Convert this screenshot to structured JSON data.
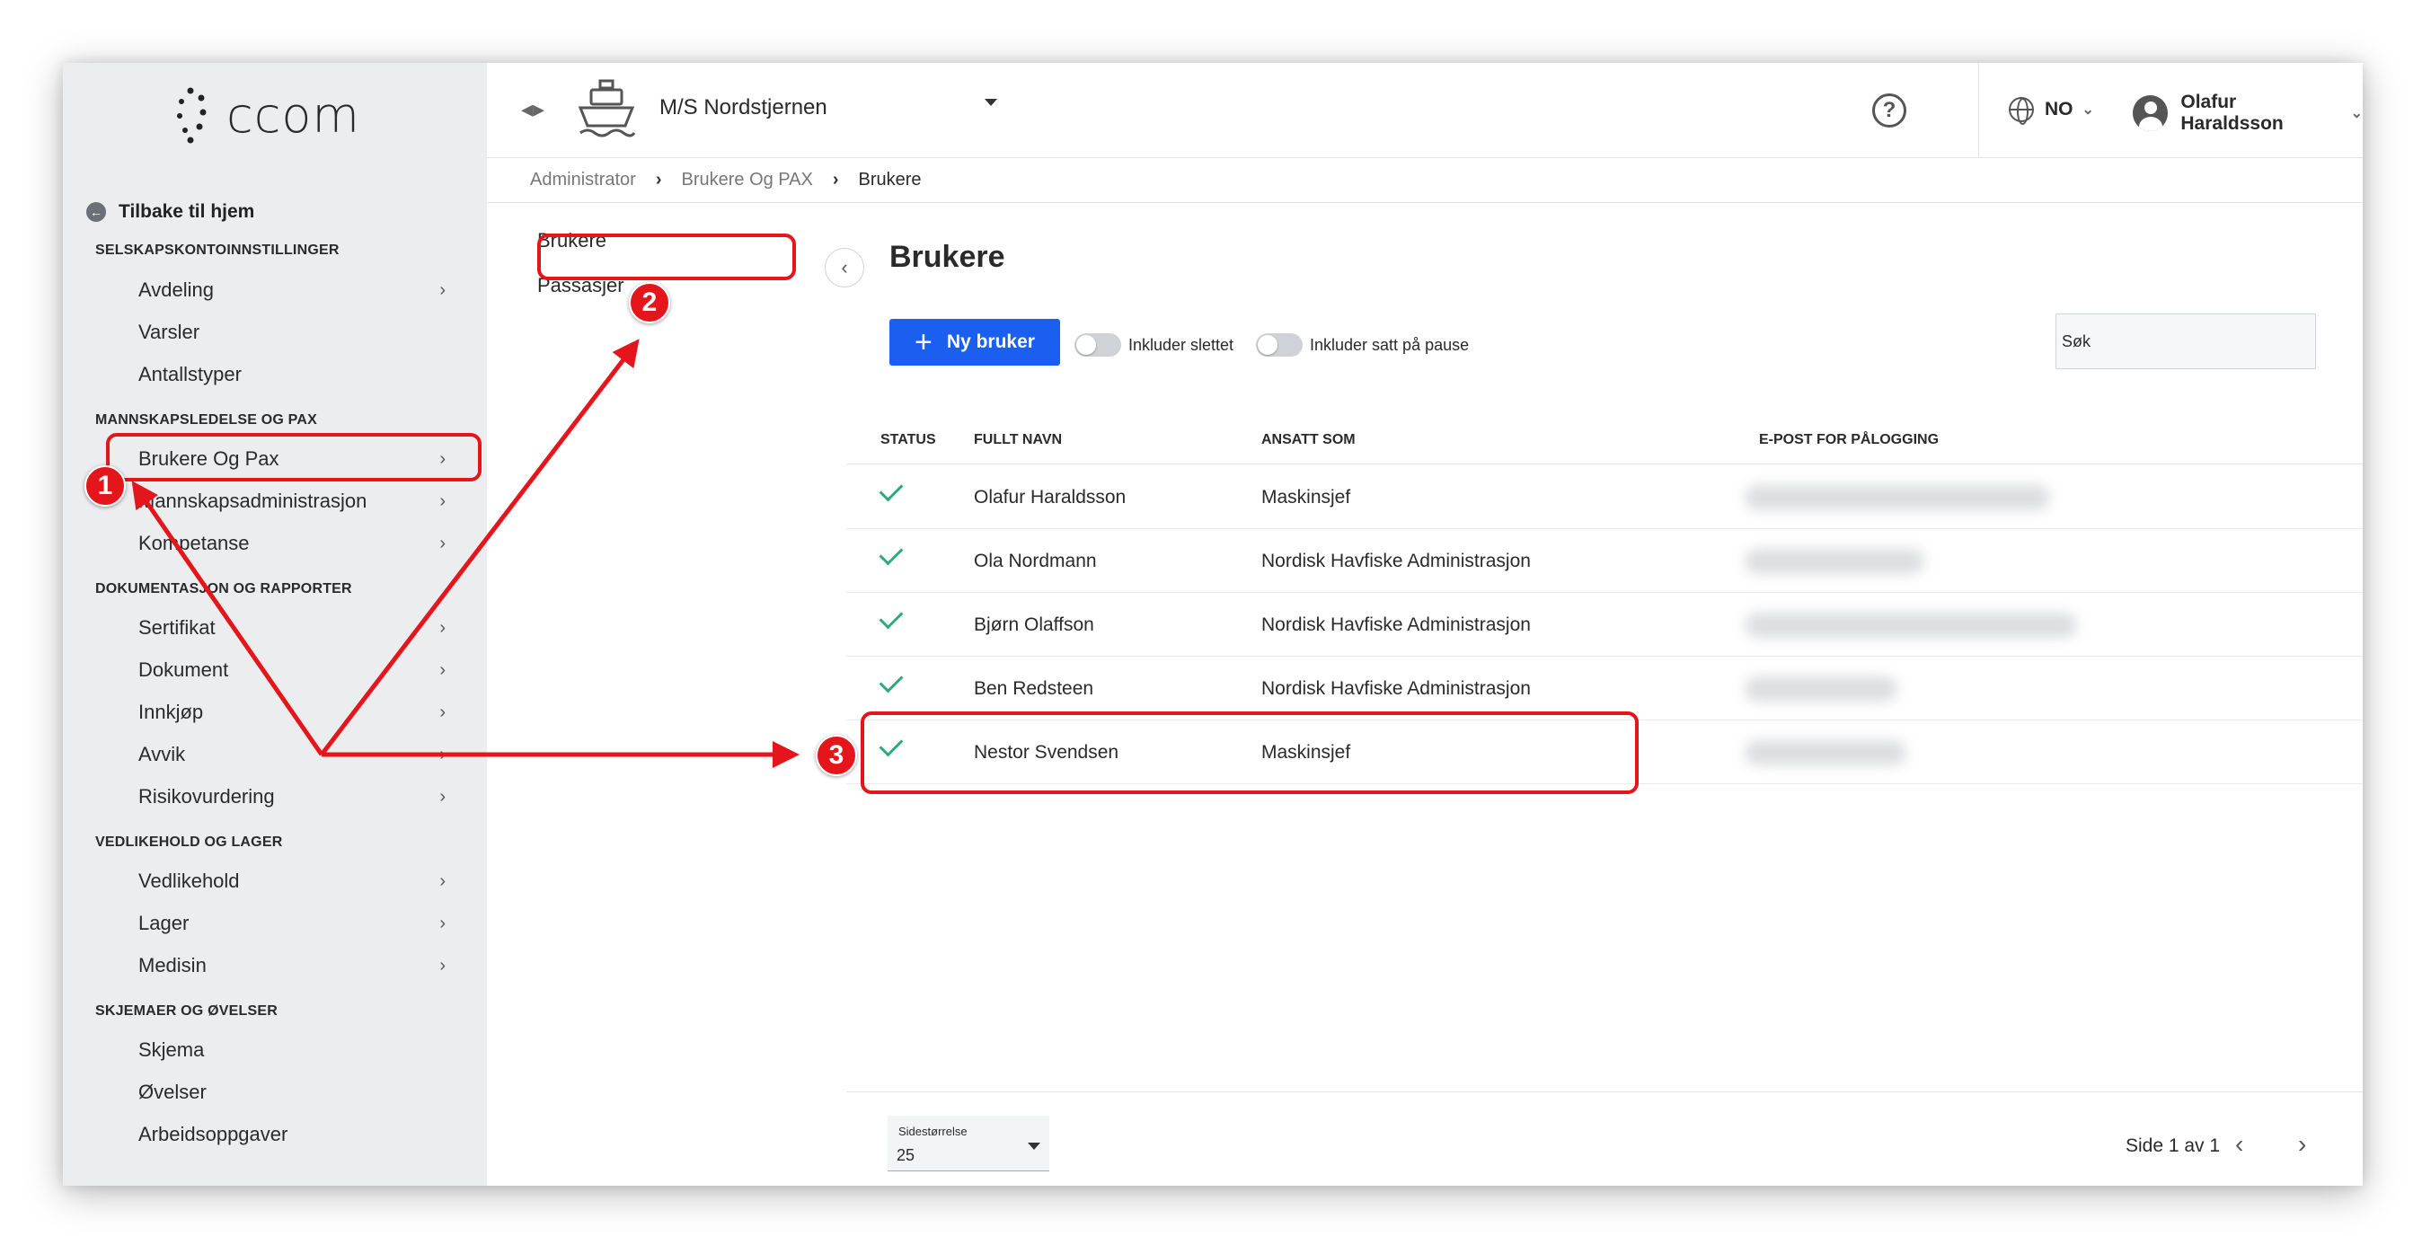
{
  "app": {
    "logo_text": "ccom"
  },
  "sidebar": {
    "back_home": "Tilbake til hjem",
    "sections": [
      {
        "title": "SELSKAPSKONTOINNSTILLINGER",
        "items": [
          {
            "label": "Avdeling",
            "chevron": true
          },
          {
            "label": "Varsler",
            "chevron": false
          },
          {
            "label": "Antallstyper",
            "chevron": false
          }
        ]
      },
      {
        "title": "MANNSKAPSLEDELSE OG PAX",
        "items": [
          {
            "label": "Brukere Og Pax",
            "chevron": true
          },
          {
            "label": "Mannskapsadministrasjon",
            "chevron": true
          },
          {
            "label": "Kompetanse",
            "chevron": true
          }
        ]
      },
      {
        "title": "DOKUMENTASJON OG RAPPORTER",
        "items": [
          {
            "label": "Sertifikat",
            "chevron": true
          },
          {
            "label": "Dokument",
            "chevron": true
          },
          {
            "label": "Innkjøp",
            "chevron": true
          },
          {
            "label": "Avvik",
            "chevron": true
          },
          {
            "label": "Risikovurdering",
            "chevron": true
          }
        ]
      },
      {
        "title": "VEDLIKEHOLD OG LAGER",
        "items": [
          {
            "label": "Vedlikehold",
            "chevron": true
          },
          {
            "label": "Lager",
            "chevron": true
          },
          {
            "label": "Medisin",
            "chevron": true
          }
        ]
      },
      {
        "title": "SKJEMAER OG ØVELSER",
        "items": [
          {
            "label": "Skjema",
            "chevron": false
          },
          {
            "label": "Øvelser",
            "chevron": false
          },
          {
            "label": "Arbeidsoppgaver",
            "chevron": false
          }
        ]
      }
    ]
  },
  "topbar": {
    "vessel": "M/S Nordstjernen",
    "help_symbol": "?",
    "language": "NO",
    "user": "Olafur Haraldsson"
  },
  "breadcrumb": [
    "Administrator",
    "Brukere Og PAX",
    "Brukere"
  ],
  "submenu": [
    "Brukere",
    "Passasjer"
  ],
  "main": {
    "title": "Brukere",
    "new_user_label": "Ny bruker",
    "toggle_deleted": "Inkluder slettet",
    "toggle_paused": "Inkluder satt på pause",
    "search_placeholder": "Søk",
    "columns": [
      "STATUS",
      "FULLT NAVN",
      "ANSATT SOM",
      "E-POST FOR PÅLOGGING"
    ],
    "rows": [
      {
        "name": "Olafur Haraldsson",
        "role": "Maskinsjef"
      },
      {
        "name": "Ola Nordmann",
        "role": "Nordisk Havfiske Administrasjon"
      },
      {
        "name": "Bjørn Olaffson",
        "role": "Nordisk Havfiske Administrasjon"
      },
      {
        "name": "Ben Redsteen",
        "role": "Nordisk Havfiske Administrasjon"
      },
      {
        "name": "Nestor Svendsen",
        "role": "Maskinsjef"
      }
    ],
    "page_size_label": "Sidestørrelse",
    "page_size_value": "25",
    "page_info": "Side 1 av 1"
  },
  "annotations": [
    "1",
    "2",
    "3"
  ],
  "colors": {
    "accent": "#1a5ff0",
    "annotation": "#e4161b",
    "status_ok": "#2eaa78"
  }
}
